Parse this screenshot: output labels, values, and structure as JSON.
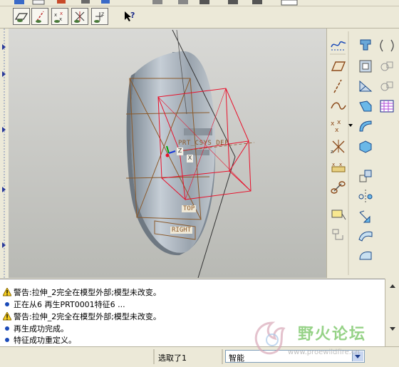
{
  "toolbar_datum": {
    "buttons": [
      {
        "name": "datum-plane-display-icon",
        "pressed": true
      },
      {
        "name": "datum-axis-display-icon",
        "pressed": true
      },
      {
        "name": "datum-point-display-icon",
        "pressed": true
      },
      {
        "name": "datum-csys-display-icon",
        "pressed": true
      },
      {
        "name": "spin-center-display-icon",
        "pressed": true
      },
      {
        "name": "context-help-icon",
        "pressed": false
      }
    ]
  },
  "viewport": {
    "labels": {
      "csys": "PRT_CSYS_DEF",
      "top": "TOP",
      "right": "RIGHT",
      "z_axis": "Z",
      "x_axis": "X"
    },
    "colors": {
      "part": "#a9b3bd",
      "datum_plane": "#8b5a2b",
      "selection": "#e8102a",
      "csys_axis": "#00a000"
    }
  },
  "right_toolbar": {
    "icons": [
      "sketch-curve-icon",
      "extrude-icon",
      "revolve-icon",
      "datum-plane-icon",
      "hole-icon",
      "shell-icon",
      "datum-axis-icon",
      "rib-icon",
      "draft-icon",
      "datum-curve-icon",
      "round-icon",
      "chamfer-icon",
      "datum-point-icon",
      "pattern-icon",
      "csys-icon",
      "copy-icon",
      "analysis-icon",
      "mirror-icon",
      "sketcher-icon",
      "move-icon",
      "insert-feature-icon",
      "surface-icon",
      "merge-icon"
    ]
  },
  "messages": [
    {
      "type": "warning",
      "text": "警告:拉伸_2完全在模型外部;模型未改变。"
    },
    {
      "type": "info",
      "text": "正在从6 再生PRT0001特征6 ..."
    },
    {
      "type": "warning",
      "text": "警告:拉伸_2完全在模型外部;模型未改变。"
    },
    {
      "type": "info",
      "text": "再生成功完成。"
    },
    {
      "type": "info",
      "text": "特征成功重定义。"
    }
  ],
  "status_bar": {
    "selection_status": "选取了1",
    "filter_value": "智能"
  },
  "watermark": {
    "title": "野火论坛",
    "url": "www.proewildfire.cn"
  }
}
